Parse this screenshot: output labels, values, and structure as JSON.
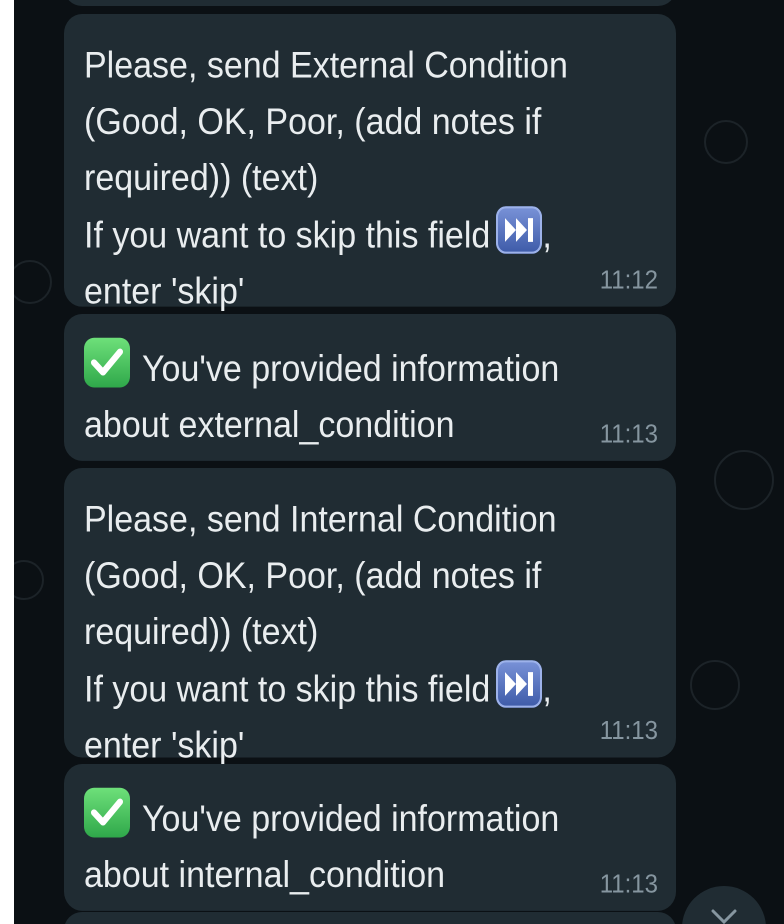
{
  "messages": [
    {
      "lines": [
        "Please, send External Condition",
        "(Good, OK, Poor, (add notes if",
        "required)) (text)"
      ],
      "skip_line": " If you want to skip this field",
      "skip_suffix": ",",
      "last_line": "enter 'skip'",
      "time": "11:12"
    },
    {
      "line1": "You've provided information",
      "line2": "about external_condition",
      "time": "11:13"
    },
    {
      "lines": [
        "Please, send Internal Condition",
        "(Good, OK, Poor, (add notes if",
        "required)) (text)"
      ],
      "skip_line": " If you want to skip this field",
      "skip_suffix": ",",
      "last_line": "enter 'skip'",
      "time": "11:13"
    },
    {
      "line1": "You've provided information",
      "line2": "about internal_condition",
      "time": "11:13"
    }
  ],
  "icons": {
    "skip": "next-track-emoji",
    "check": "white-check-mark-emoji",
    "scroll": "chevron-down-icon"
  },
  "colors": {
    "background": "#0b1014",
    "bubble": "#202c33",
    "text": "#e9edef",
    "time": "#8696a0"
  }
}
